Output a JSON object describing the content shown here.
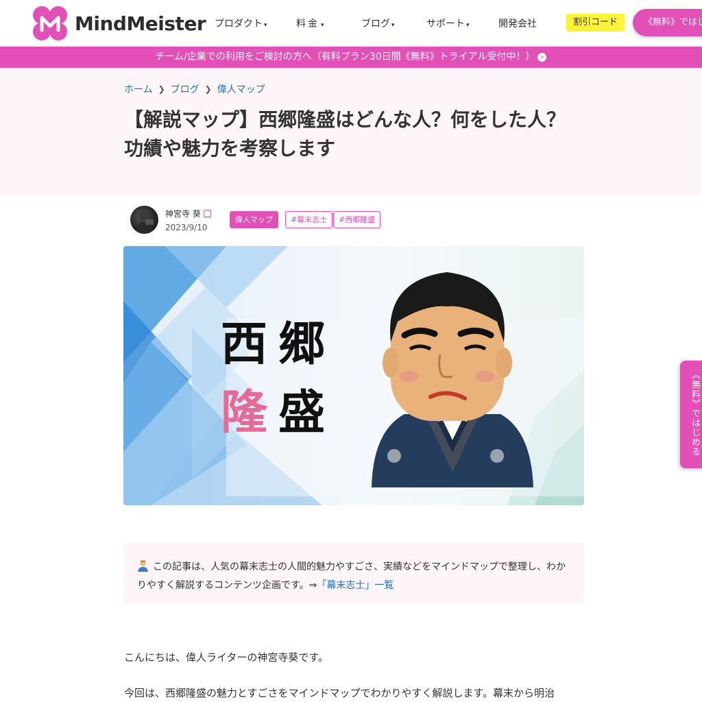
{
  "header": {
    "brand": "MindMeister",
    "nav": [
      {
        "label": "プロダクト",
        "chevron": true
      },
      {
        "label": "料金",
        "chevron": true
      },
      {
        "label": "ブログ",
        "chevron": true
      },
      {
        "label": "サポート",
        "chevron": true
      },
      {
        "label": "開発会社",
        "chevron": false
      }
    ],
    "coupon_label": "割引コード",
    "cta_label": "《無料》ではじめ",
    "accent_color": "#e24fb6",
    "coupon_color": "#fff33a"
  },
  "banner": {
    "text": "チーム/企業での利用をご検討の方へ（有料プラン30日間《無料》トライアル受付中！）"
  },
  "breadcrumb": [
    "ホーム",
    "ブログ",
    "偉人マップ"
  ],
  "article": {
    "title": "【解説マップ】西郷隆盛はどんな人？何をした人？功績や魅力を考察します",
    "author": "神宮寺 葵",
    "date": "2023/9/10",
    "tags": [
      "偉人マップ",
      "#幕末志士",
      "#西郷隆盛"
    ],
    "hero_words": [
      "西",
      "郷",
      "隆",
      "盛"
    ],
    "info_text": "この記事は、人気の幕末志士の人間的魅力やすごさ、実績などをマインドマップで整理し、わかりやすく解説するコンテンツ企画です。⇒",
    "info_link": "「幕末志士」一覧",
    "paragraphs": [
      "こんにちは、偉人ライターの神宮寺葵です。",
      "今回は、西郷隆盛の魅力とすごさをマインドマップでわかりやすく解説します。幕末から明治"
    ]
  },
  "side_cta_label": "《無料》ではじめる"
}
